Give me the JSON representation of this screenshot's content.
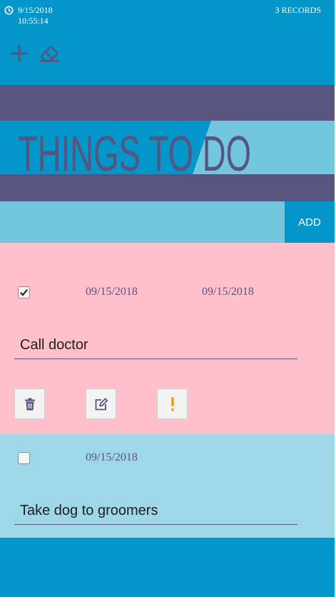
{
  "header": {
    "date": "9/15/2018",
    "time": "10:55:14",
    "records": "3 RECORDS"
  },
  "banner": {
    "title": "THINGS TO DO"
  },
  "add_bar": {
    "input_value": "",
    "button_label": "ADD"
  },
  "items": [
    {
      "completed": true,
      "date_created": "09/15/2018",
      "date_due": "09/15/2018",
      "title": "Call doctor",
      "priority": "important"
    },
    {
      "completed": false,
      "date_created": "09/15/2018",
      "title": "Take dog to groomers"
    }
  ],
  "colors": {
    "primary": "#0396cb",
    "band": "#57547f",
    "light_blue": "#72c7de",
    "item_pink": "#ffc0cb",
    "item_blue": "#9ed8e8",
    "warning": "#f39c12"
  },
  "icons": [
    "clock-icon",
    "plus-icon",
    "eraser-icon",
    "checkmark-icon",
    "trash-icon",
    "edit-icon",
    "exclamation-icon"
  ]
}
